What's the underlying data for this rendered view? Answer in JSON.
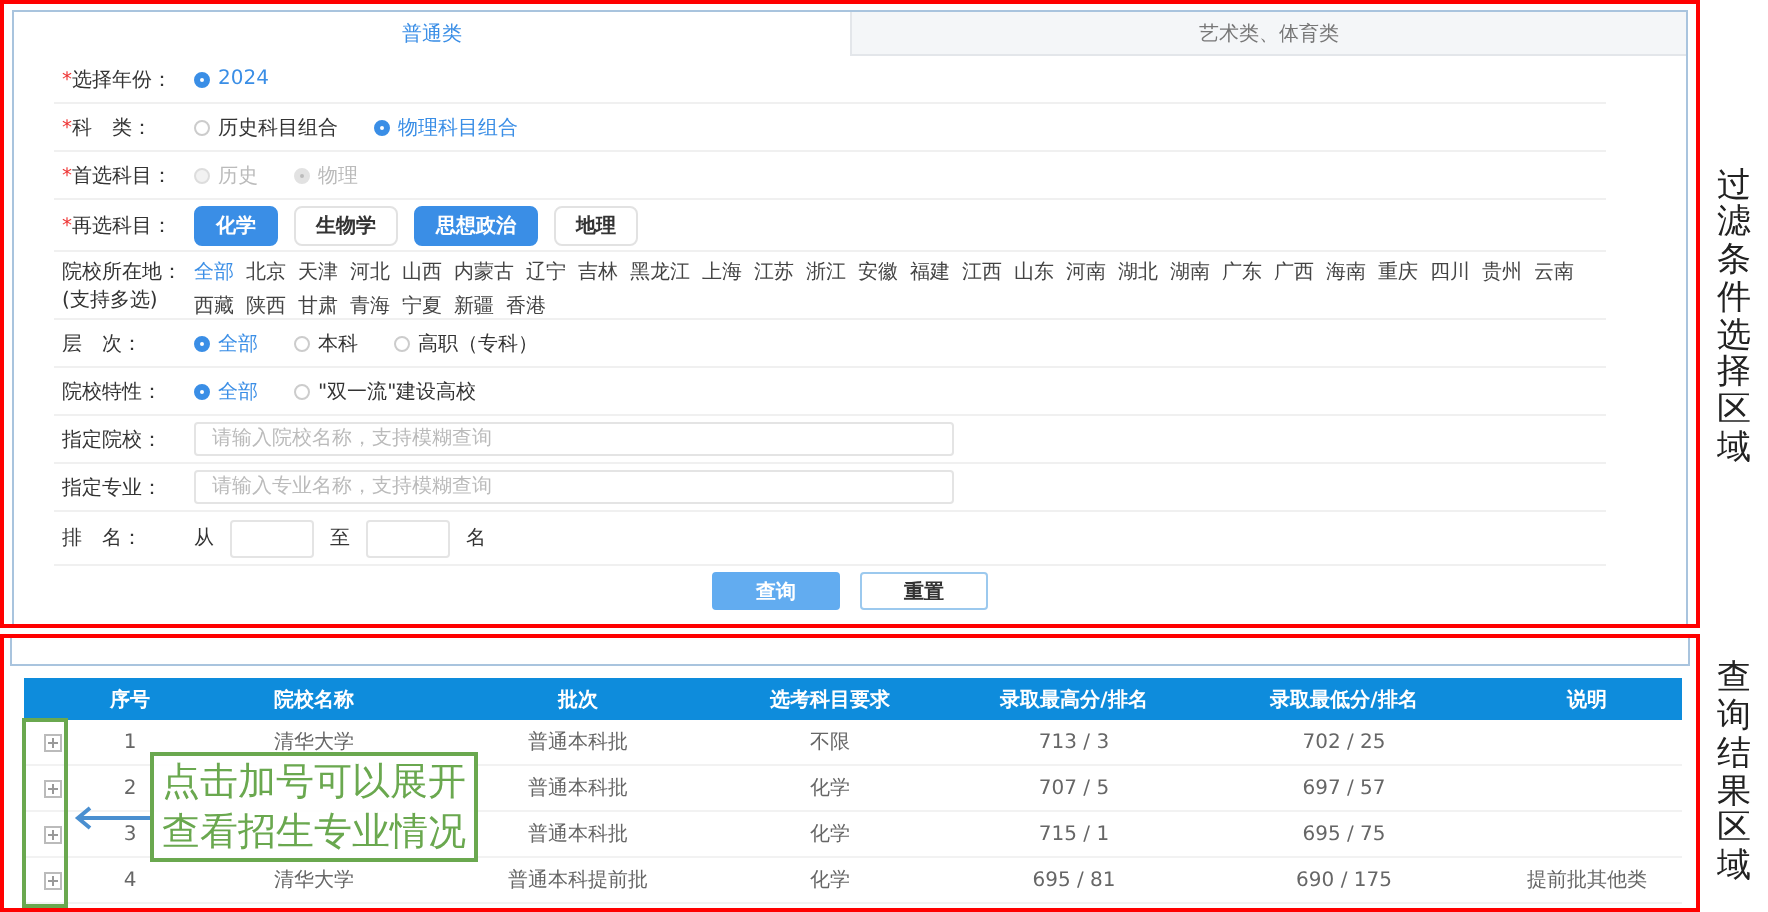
{
  "tabs": [
    {
      "label": "普通类",
      "selected": true
    },
    {
      "label": "艺术类、体育类",
      "selected": false
    }
  ],
  "filters": [
    {
      "kind": "radio",
      "mark": "*",
      "label": "选择年份：",
      "options": [
        {
          "label": "2024",
          "selected": true
        }
      ]
    },
    {
      "kind": "radio",
      "mark": "*",
      "label": "科　类：",
      "options": [
        {
          "label": "历史科目组合",
          "selected": false
        },
        {
          "label": "物理科目组合",
          "selected": true
        }
      ]
    },
    {
      "kind": "radio",
      "mark": "*",
      "label": "首选科目：",
      "options": [
        {
          "label": "历史",
          "selected": false,
          "disabled": true
        },
        {
          "label": "物理",
          "selected": true,
          "disabled": true
        }
      ]
    },
    {
      "kind": "chips",
      "mark": "*",
      "label": "再选科目：",
      "options": [
        {
          "label": "化学",
          "selected": true
        },
        {
          "label": "生物学",
          "selected": false
        },
        {
          "label": "思想政治",
          "selected": true
        },
        {
          "label": "地理",
          "selected": false
        }
      ]
    },
    {
      "kind": "tags",
      "label": "院校所在地：",
      "note": "(支持多选)",
      "options": [
        {
          "label": "全部",
          "selected": true
        },
        {
          "label": "北京",
          "selected": false
        },
        {
          "label": "天津",
          "selected": false
        },
        {
          "label": "河北",
          "selected": false
        },
        {
          "label": "山西",
          "selected": false
        },
        {
          "label": "内蒙古",
          "selected": false
        },
        {
          "label": "辽宁",
          "selected": false
        },
        {
          "label": "吉林",
          "selected": false
        },
        {
          "label": "黑龙江",
          "selected": false
        },
        {
          "label": "上海",
          "selected": false
        },
        {
          "label": "江苏",
          "selected": false
        },
        {
          "label": "浙江",
          "selected": false
        },
        {
          "label": "安徽",
          "selected": false
        },
        {
          "label": "福建",
          "selected": false
        },
        {
          "label": "江西",
          "selected": false
        },
        {
          "label": "山东",
          "selected": false
        },
        {
          "label": "河南",
          "selected": false
        },
        {
          "label": "湖北",
          "selected": false
        },
        {
          "label": "湖南",
          "selected": false
        },
        {
          "label": "广东",
          "selected": false
        },
        {
          "label": "广西",
          "selected": false
        },
        {
          "label": "海南",
          "selected": false
        },
        {
          "label": "重庆",
          "selected": false
        },
        {
          "label": "四川",
          "selected": false
        },
        {
          "label": "贵州",
          "selected": false
        },
        {
          "label": "云南",
          "selected": false
        },
        {
          "label": "西藏",
          "selected": false
        },
        {
          "label": "陕西",
          "selected": false
        },
        {
          "label": "甘肃",
          "selected": false
        },
        {
          "label": "青海",
          "selected": false
        },
        {
          "label": "宁夏",
          "selected": false
        },
        {
          "label": "新疆",
          "selected": false
        },
        {
          "label": "香港",
          "selected": false
        }
      ]
    },
    {
      "kind": "radio",
      "label": "层　次：",
      "options": [
        {
          "label": "全部",
          "selected": true
        },
        {
          "label": "本科",
          "selected": false
        },
        {
          "label": "高职（专科）",
          "selected": false
        }
      ]
    },
    {
      "kind": "radio",
      "label": "院校特性：",
      "options": [
        {
          "label": "全部",
          "selected": true
        },
        {
          "label": "\"双一流\"建设高校",
          "selected": false
        }
      ]
    },
    {
      "kind": "input",
      "label": "指定院校：",
      "placeholder": "请输入院校名称，支持模糊查询"
    },
    {
      "kind": "input",
      "label": "指定专业：",
      "placeholder": "请输入专业名称，支持模糊查询"
    },
    {
      "kind": "range",
      "label": "排　名：",
      "from": "从",
      "to": "至",
      "unit": "名"
    }
  ],
  "buttons": [
    {
      "label": "查询",
      "kind": "primary"
    },
    {
      "label": "重置",
      "kind": "default"
    }
  ],
  "table": {
    "columns": [
      "序号",
      "院校名称",
      "批次",
      "选考科目要求",
      "录取最高分/排名",
      "录取最低分/排名",
      "说明"
    ],
    "rows": [
      {
        "cells": [
          "1",
          "清华大学",
          "普通本科批",
          "不限",
          "713 / 3",
          "702 / 25",
          ""
        ]
      },
      {
        "cells": [
          "2",
          "",
          "普通本科批",
          "化学",
          "707 / 5",
          "697 / 57",
          ""
        ]
      },
      {
        "cells": [
          "3",
          "",
          "普通本科批",
          "化学",
          "715 / 1",
          "695 / 75",
          ""
        ]
      },
      {
        "cells": [
          "4",
          "清华大学",
          "普通本科提前批",
          "化学",
          "695 / 81",
          "690 / 175",
          "提前批其他类"
        ]
      }
    ]
  },
  "annotations": {
    "filter_label": "过滤条件选择区域",
    "result_label": "查询结果区域",
    "callout": "点击加号可以展开查看招生专业情况"
  }
}
